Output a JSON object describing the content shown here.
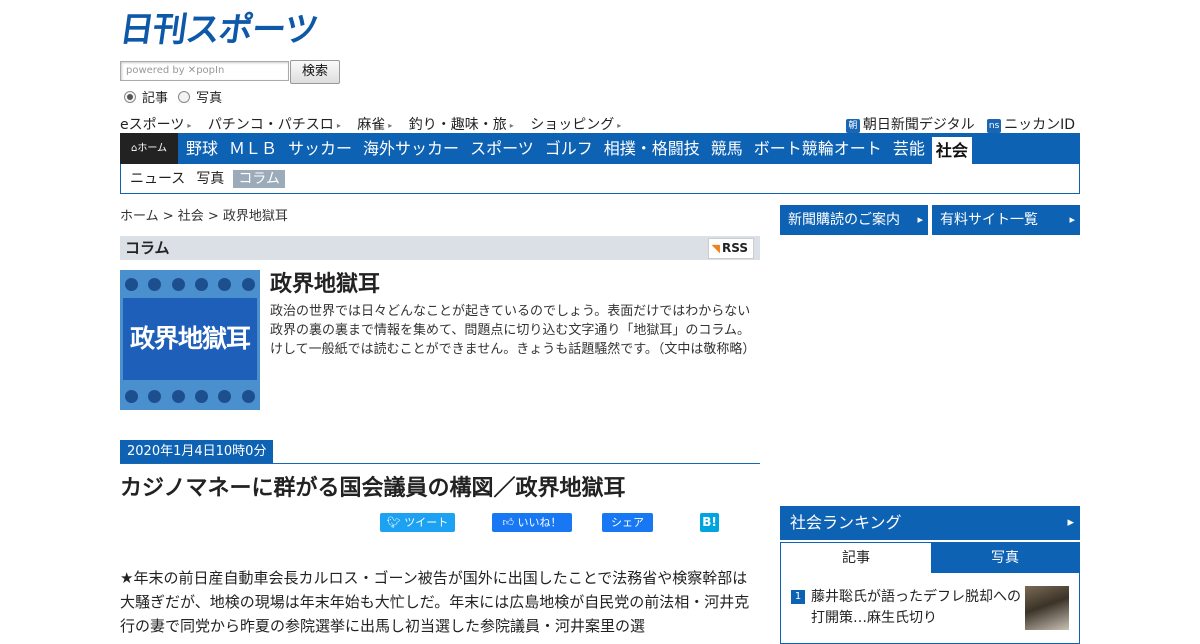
{
  "header": {
    "logo_text": "日刊スポーツ",
    "search_placeholder": "powered by ✕popIn",
    "search_button": "検索",
    "radio_options": [
      "記事",
      "写真"
    ]
  },
  "subnav": {
    "items": [
      "eスポーツ",
      "パチンコ・パチスロ",
      "麻雀",
      "釣り・趣味・旅",
      "ショッピング"
    ],
    "right_links": [
      {
        "badge": "朝",
        "label": "朝日新聞デジタル"
      },
      {
        "badge": "ns",
        "label": "ニッカンID"
      }
    ]
  },
  "mainnav": {
    "home_label": "ホーム",
    "tabs": [
      "野球",
      "ＭＬＢ",
      "サッカー",
      "海外サッカー",
      "スポーツ",
      "ゴルフ",
      "相撲・格闘技",
      "競馬",
      "ボート競輪オート",
      "芸能",
      "社会"
    ],
    "active_tab": "社会"
  },
  "subtabs": [
    "ニュース",
    "写真",
    "コラム"
  ],
  "breadcrumb": "ホーム > 社会 > 政界地獄耳",
  "column": {
    "section_label": "コラム",
    "rss_label": "RSS",
    "thumb_text": "政界地獄耳",
    "title": "政界地獄耳",
    "description": "政治の世界では日々どんなことが起きているのでしょう。表面だけではわからない政界の裏の裏まで情報を集めて、問題点に切り込む文字通り「地獄耳」のコラム。けして一般紙では読むことができません。きょうも話題騒然です。（文中は敬称略）"
  },
  "article": {
    "date": "2020年1月4日10時0分",
    "headline": "カジノマネーに群がる国会議員の構図／政界地獄耳",
    "share": {
      "tweet": "ツイート",
      "like": "いいね！",
      "share": "シェア",
      "hatena": "B!"
    },
    "body": "★年末の前日産自動車会長カルロス・ゴーン被告が国外に出国したことで法務省や検察幹部は大騒ぎだが、地検の現場は年末年始も大忙しだ。年末には広島地検が自民党の前法相・河井克行の妻で同党から昨夏の参院選挙に出馬し初当選した参院議員・河井案里の選"
  },
  "sidebar": {
    "buttons": [
      "新聞購読のご案内",
      "有料サイト一覧"
    ],
    "ranking_title": "社会ランキング",
    "ranking_tabs": [
      "記事",
      "写真"
    ],
    "ranking_items": [
      {
        "rank": "1",
        "text": "藤井聡氏が語ったデフレ脱却への打開策…麻生氏切り"
      }
    ]
  },
  "colors": {
    "brand": "#0e62b3",
    "home_tab": "#222222",
    "rss_icon": "#f0821e"
  }
}
